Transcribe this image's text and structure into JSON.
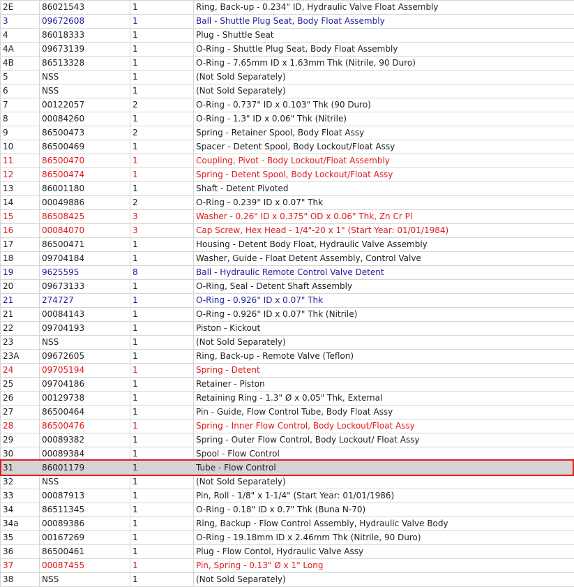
{
  "parts_table": {
    "highlight_color": "#e31b23",
    "colors": {
      "blue": "#1f1f9e",
      "red": "#e0191b",
      "default": "#222222"
    },
    "rows": [
      {
        "ref": "2E",
        "part": "86021543",
        "qty": "1",
        "desc": "Ring, Back-up - 0.234\" ID, Hydraulic Valve Float Assembly",
        "style": ""
      },
      {
        "ref": "3",
        "part": "09672608",
        "qty": "1",
        "desc": "Ball - Shuttle Plug Seat, Body Float Assembly",
        "style": "blue"
      },
      {
        "ref": "4",
        "part": "86018333",
        "qty": "1",
        "desc": "Plug - Shuttle Seat",
        "style": ""
      },
      {
        "ref": "4A",
        "part": "09673139",
        "qty": "1",
        "desc": "O-Ring - Shuttle Plug Seat, Body Float Assembly",
        "style": ""
      },
      {
        "ref": "4B",
        "part": "86513328",
        "qty": "1",
        "desc": "O-Ring - 7.65mm ID x 1.63mm Thk (Nitrile, 90 Duro)",
        "style": ""
      },
      {
        "ref": "5",
        "part": "NSS",
        "qty": "1",
        "desc": "(Not Sold Separately)",
        "style": ""
      },
      {
        "ref": "6",
        "part": "NSS",
        "qty": "1",
        "desc": "(Not Sold Separately)",
        "style": ""
      },
      {
        "ref": "7",
        "part": "00122057",
        "qty": "2",
        "desc": "O-Ring - 0.737\" ID x 0.103\" Thk (90 Duro)",
        "style": ""
      },
      {
        "ref": "8",
        "part": "00084260",
        "qty": "1",
        "desc": "O-Ring - 1.3\" ID x 0.06\" Thk (Nitrile)",
        "style": ""
      },
      {
        "ref": "9",
        "part": "86500473",
        "qty": "2",
        "desc": "Spring - Retainer Spool, Body Float Assy",
        "style": ""
      },
      {
        "ref": "10",
        "part": "86500469",
        "qty": "1",
        "desc": "Spacer - Detent Spool, Body Lockout/Float Assy",
        "style": ""
      },
      {
        "ref": "11",
        "part": "86500470",
        "qty": "1",
        "desc": "Coupling, Pivot - Body Lockout/Float Assembly",
        "style": "red"
      },
      {
        "ref": "12",
        "part": "86500474",
        "qty": "1",
        "desc": "Spring - Detent Spool, Body Lockout/Float Assy",
        "style": "red"
      },
      {
        "ref": "13",
        "part": "86001180",
        "qty": "1",
        "desc": "Shaft - Detent Pivoted",
        "style": ""
      },
      {
        "ref": "14",
        "part": "00049886",
        "qty": "2",
        "desc": "O-Ring - 0.239\" ID x 0.07\" Thk",
        "style": ""
      },
      {
        "ref": "15",
        "part": "86508425",
        "qty": "3",
        "desc": "Washer - 0.26\" ID x 0.375\" OD x 0.06\" Thk, Zn Cr Pl",
        "style": "red"
      },
      {
        "ref": "16",
        "part": "00084070",
        "qty": "3",
        "desc": "Cap Screw, Hex Head - 1/4\"-20 x 1\" (Start Year: 01/01/1984)",
        "style": "red"
      },
      {
        "ref": "17",
        "part": "86500471",
        "qty": "1",
        "desc": "Housing - Detent Body Float, Hydraulic Valve Assembly",
        "style": ""
      },
      {
        "ref": "18",
        "part": "09704184",
        "qty": "1",
        "desc": "Washer, Guide - Float Detent Assembly, Control Valve",
        "style": ""
      },
      {
        "ref": "19",
        "part": "9625595",
        "qty": "8",
        "desc": "Ball - Hydraulic Remote Control Valve Detent",
        "style": "blue"
      },
      {
        "ref": "20",
        "part": "09673133",
        "qty": "1",
        "desc": "O-Ring, Seal - Detent Shaft Assembly",
        "style": ""
      },
      {
        "ref": "21",
        "part": "274727",
        "qty": "1",
        "desc": "O-Ring - 0.926\" ID x 0.07\" Thk",
        "style": "blue"
      },
      {
        "ref": "21",
        "part": "00084143",
        "qty": "1",
        "desc": "O-Ring - 0.926\" ID x 0.07\" Thk (Nitrile)",
        "style": ""
      },
      {
        "ref": "22",
        "part": "09704193",
        "qty": "1",
        "desc": "Piston - Kickout",
        "style": ""
      },
      {
        "ref": "23",
        "part": "NSS",
        "qty": "1",
        "desc": "(Not Sold Separately)",
        "style": ""
      },
      {
        "ref": "23A",
        "part": "09672605",
        "qty": "1",
        "desc": "Ring, Back-up - Remote Valve (Teflon)",
        "style": ""
      },
      {
        "ref": "24",
        "part": "09705194",
        "qty": "1",
        "desc": "Spring - Detent",
        "style": "red"
      },
      {
        "ref": "25",
        "part": "09704186",
        "qty": "1",
        "desc": "Retainer - Piston",
        "style": ""
      },
      {
        "ref": "26",
        "part": "00129738",
        "qty": "1",
        "desc": "Retaining Ring - 1.3\" Ø x 0.05\" Thk, External",
        "style": ""
      },
      {
        "ref": "27",
        "part": "86500464",
        "qty": "1",
        "desc": "Pin - Guide, Flow Control Tube, Body Float Assy",
        "style": ""
      },
      {
        "ref": "28",
        "part": "86500476",
        "qty": "1",
        "desc": "Spring - Inner Flow Control, Body Lockout/Float Assy",
        "style": "red"
      },
      {
        "ref": "29",
        "part": "00089382",
        "qty": "1",
        "desc": "Spring - Outer Flow Control, Body Lockout/ Float Assy",
        "style": ""
      },
      {
        "ref": "30",
        "part": "00089384",
        "qty": "1",
        "desc": "Spool - Flow Control",
        "style": ""
      },
      {
        "ref": "31",
        "part": "86001179",
        "qty": "1",
        "desc": "Tube - Flow Control",
        "style": "selected"
      },
      {
        "ref": "32",
        "part": "NSS",
        "qty": "1",
        "desc": "(Not Sold Separately)",
        "style": ""
      },
      {
        "ref": "33",
        "part": "00087913",
        "qty": "1",
        "desc": "Pin, Roll - 1/8\" x 1-1/4\" (Start Year: 01/01/1986)",
        "style": ""
      },
      {
        "ref": "34",
        "part": "86511345",
        "qty": "1",
        "desc": "O-Ring - 0.18\" ID x 0.7\" Thk (Buna N-70)",
        "style": ""
      },
      {
        "ref": "34a",
        "part": "00089386",
        "qty": "1",
        "desc": "Ring, Backup - Flow Control Assembly, Hydraulic Valve Body",
        "style": ""
      },
      {
        "ref": "35",
        "part": "00167269",
        "qty": "1",
        "desc": "O-Ring - 19.18mm ID x 2.46mm Thk (Nitrile, 90 Duro)",
        "style": ""
      },
      {
        "ref": "36",
        "part": "86500461",
        "qty": "1",
        "desc": "Plug - Flow Contol, Hydraulic Valve Assy",
        "style": ""
      },
      {
        "ref": "37",
        "part": "00087455",
        "qty": "1",
        "desc": "Pin, Spring - 0.13\" Ø x 1\" Long",
        "style": "red"
      },
      {
        "ref": "38",
        "part": "NSS",
        "qty": "1",
        "desc": "(Not Sold Separately)",
        "style": ""
      }
    ]
  }
}
